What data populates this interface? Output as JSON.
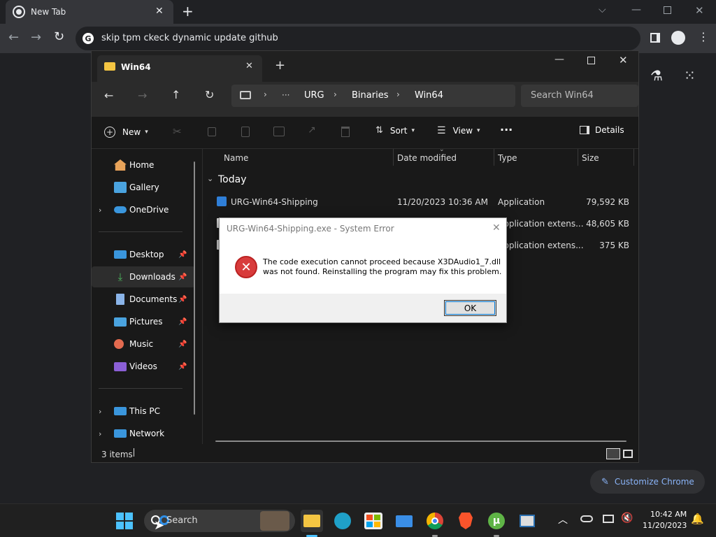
{
  "browser": {
    "tab_title": "New Tab",
    "address_text": "skip tpm ckeck dynamic update github",
    "customize_label": "Customize Chrome"
  },
  "explorer": {
    "tab_title": "Win64",
    "breadcrumb": [
      "URG",
      "Binaries",
      "Win64"
    ],
    "breadcrumb_more": "···",
    "search_placeholder": "Search Win64",
    "toolbar": {
      "new_label": "New",
      "sort_label": "Sort",
      "view_label": "View",
      "details_label": "Details"
    },
    "sidebar": {
      "home": "Home",
      "gallery": "Gallery",
      "onedrive": "OneDrive",
      "desktop": "Desktop",
      "downloads": "Downloads",
      "documents": "Documents",
      "pictures": "Pictures",
      "music": "Music",
      "videos": "Videos",
      "thispc": "This PC",
      "network": "Network"
    },
    "columns": {
      "name": "Name",
      "date": "Date modified",
      "type": "Type",
      "size": "Size"
    },
    "group_label": "Today",
    "files": [
      {
        "name": "URG-Win64-Shipping",
        "date": "11/20/2023 10:36 AM",
        "type": "Application",
        "size": "79,592 KB"
      },
      {
        "name": "",
        "date": "",
        "type": "Application extens...",
        "size": "48,605 KB"
      },
      {
        "name": "",
        "date": "",
        "type": "Application extens...",
        "size": "375 KB"
      }
    ],
    "status": "3 items"
  },
  "dialog": {
    "title": "URG-Win64-Shipping.exe - System Error",
    "message_line1": "The code execution cannot proceed because X3DAudio1_7.dll",
    "message_line2": "was not found. Reinstalling the program may fix this problem.",
    "ok_label": "OK"
  },
  "taskbar": {
    "search_label": "Search",
    "time": "10:42 AM",
    "date": "11/20/2023"
  },
  "colors": {
    "error_red": "#d83b3b",
    "accent_blue": "#4cc2ff",
    "folder_yellow": "#f4c542"
  }
}
